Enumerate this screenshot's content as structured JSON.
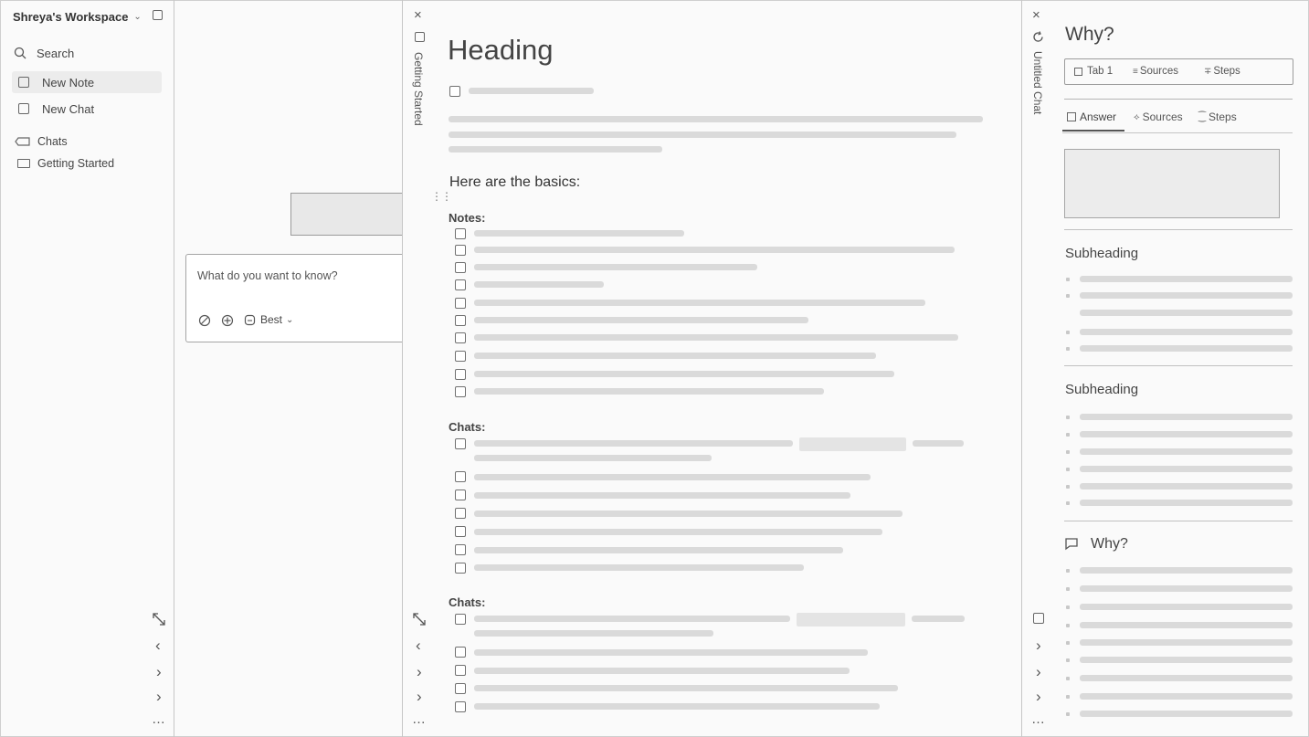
{
  "sidebar": {
    "workspace": "Shreya's Workspace",
    "search": "Search",
    "new_note": "New Note",
    "new_chat": "New Chat",
    "chats": "Chats",
    "getting_started": "Getting Started"
  },
  "chat_panel": {
    "placeholder": "What do you want to know?",
    "model": "Best"
  },
  "note": {
    "tab_label": "Getting Started",
    "heading": "Heading",
    "intro": "Here are the basics:",
    "notes_label": "Notes:",
    "chats_label_1": "Chats:",
    "chats_label_2": "Chats:"
  },
  "right": {
    "tab_label": "Untitled Chat",
    "title": "Why?",
    "top_tabs": [
      "Tab 1",
      "Sources",
      "Steps"
    ],
    "tabs": [
      "Answer",
      "Sources",
      "Steps"
    ],
    "subheading_1": "Subheading",
    "subheading_2": "Subheading",
    "why": "Why?"
  }
}
